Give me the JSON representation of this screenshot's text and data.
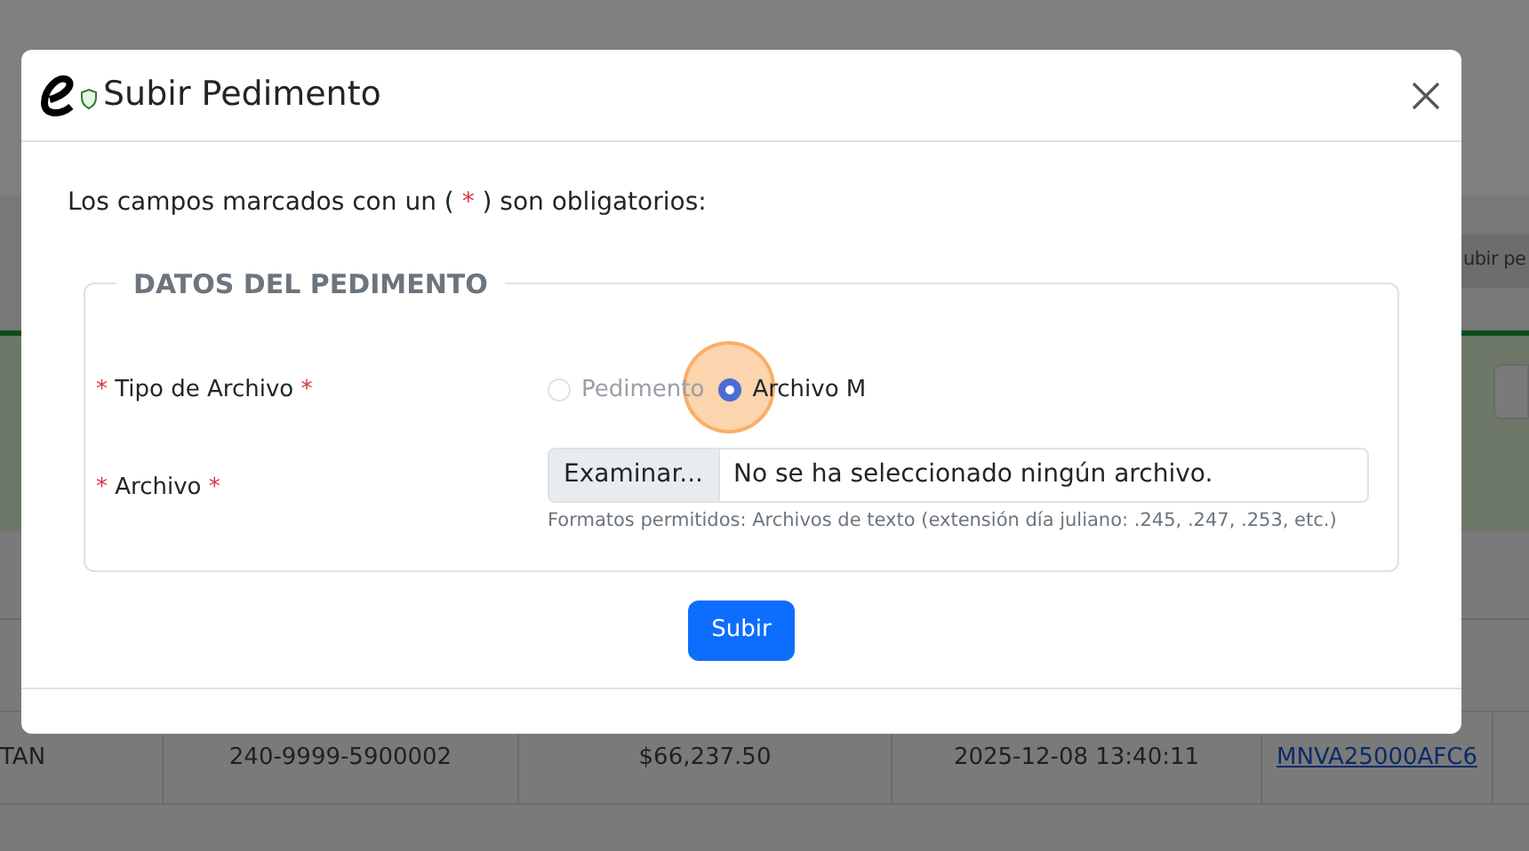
{
  "background": {
    "button": "ubir pe",
    "row": [
      "TAN",
      "240-9999-5900002",
      "$66,237.50",
      "2025-12-08 13:40:11",
      "MNVA25000AFC6"
    ]
  },
  "dialog": {
    "title": "Subir Pedimento",
    "note": {
      "before": "Los campos marcados con un (",
      "mark": "*",
      "after": ") son obligatorios:"
    },
    "section": "DATOS DEL PEDIMENTO",
    "file_type": {
      "mark_before": "*",
      "label": "Tipo de Archivo",
      "mark_after": "*",
      "options": [
        {
          "label": "Pedimento",
          "selected": false
        },
        {
          "label": "Archivo M",
          "selected": true
        }
      ]
    },
    "file": {
      "mark_before": "*",
      "label": "Archivo",
      "mark_after": "*",
      "button": "Examinar...",
      "value": "No se ha seleccionado ningún archivo.",
      "hint": "Formatos permitidos: Archivos de texto (extensión día juliano: .245, .247, .253, etc.)"
    },
    "submit": "Subir"
  }
}
